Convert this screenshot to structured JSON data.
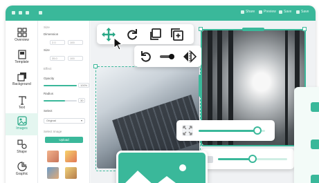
{
  "topbar": {
    "menu": [
      {
        "label": "Share"
      },
      {
        "label": "Preview"
      },
      {
        "label": "Save"
      },
      {
        "label": "Save"
      }
    ]
  },
  "sidebar": {
    "items": [
      {
        "label": "Overview",
        "icon": "grid-icon"
      },
      {
        "label": "Template",
        "icon": "template-icon"
      },
      {
        "label": "Background",
        "icon": "background-icon"
      },
      {
        "label": "Text",
        "icon": "text-icon"
      },
      {
        "label": "Images",
        "icon": "image-icon",
        "active": true
      },
      {
        "label": "Shape",
        "icon": "shape-icon"
      },
      {
        "label": "Graphic",
        "icon": "graphic-icon"
      }
    ]
  },
  "panel": {
    "section1": "Size",
    "dimensions_label": "Dimension",
    "dim_w": "2.0",
    "dim_h": "100",
    "size_label": "Size",
    "size_w": "35.0",
    "size_h": "100",
    "section2": "Effect",
    "opacity_label": "Opacity",
    "opacity_value": "100%",
    "opacity_fraction": 1.0,
    "radius_label": "Radius",
    "radius_value": "30",
    "radius_fraction": 0.65,
    "select_label": "Select",
    "select_value": "Original",
    "section3": "Select Image",
    "upload_button": "Upload"
  },
  "toolbar": {
    "tools": [
      "move-icon",
      "rotate-icon",
      "duplicate-icon",
      "add-layer-icon"
    ],
    "tools2": [
      "rotate-ccw-icon",
      "toggle-icon",
      "flip-horizontal-icon"
    ]
  },
  "zoom": {
    "fraction": 0.85
  },
  "colors": {
    "accent": "#3ab89a",
    "bg": "#f7f8f9"
  }
}
